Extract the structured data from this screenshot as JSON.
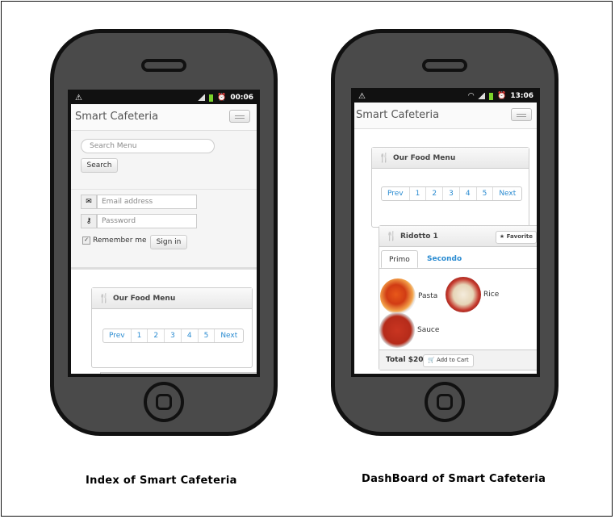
{
  "index": {
    "status": {
      "time": "00:06"
    },
    "brand": "Smart Cafeteria",
    "search": {
      "placeholder": "Search Menu",
      "button": "Search"
    },
    "login": {
      "email_placeholder": "Email address",
      "password_placeholder": "Password",
      "remember": "Remember me",
      "signin": "Sign in"
    },
    "menu_panel": {
      "title": "Our Food Menu"
    },
    "pager": [
      "Prev",
      "1",
      "2",
      "3",
      "4",
      "5",
      "Next"
    ],
    "caption": "Index of Smart Cafeteria"
  },
  "dashboard": {
    "status": {
      "time": "13:06"
    },
    "brand": "Smart Cafeteria",
    "menu_panel": {
      "title": "Our Food Menu"
    },
    "pager": [
      "Prev",
      "1",
      "2",
      "3",
      "4",
      "5",
      "Next"
    ],
    "food_panel": {
      "title": "Ridotto 1",
      "favorite": "Favorite",
      "tabs": [
        "Primo",
        "Secondo"
      ],
      "dishes": [
        "Pasta",
        "Rice",
        "Sauce"
      ],
      "total": "Total $20",
      "add_to_cart": "Add to Cart"
    },
    "caption": "DashBoard of Smart Cafeteria"
  },
  "icons": [
    "warning-icon",
    "signal-icon",
    "battery-icon",
    "alarm-icon",
    "wifi-icon",
    "menu-icon",
    "envelope-icon",
    "key-icon",
    "cutlery-icon",
    "star-icon",
    "cart-icon"
  ]
}
